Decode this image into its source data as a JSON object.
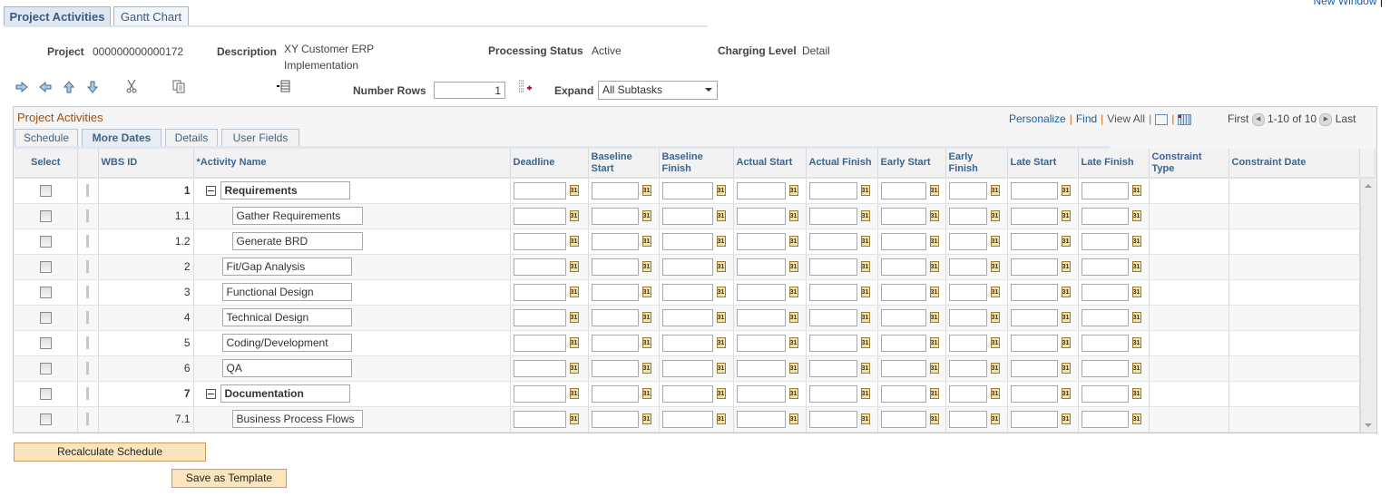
{
  "top_tabs": [
    {
      "label": "Project Activities",
      "active": true
    },
    {
      "label": "Gantt Chart",
      "active": false
    }
  ],
  "new_window": "New Window",
  "header": {
    "project_label": "Project",
    "project_value": "000000000000172",
    "description_label": "Description",
    "description_line1": "XY Customer ERP",
    "description_line2": "Implementation",
    "status_label": "Processing Status",
    "status_value": "Active",
    "charging_label": "Charging Level",
    "charging_value": "Detail"
  },
  "toolbar": {
    "icons": [
      "indent-right-arrow-icon",
      "outdent-left-arrow-icon",
      "move-up-arrow-icon",
      "move-down-arrow-icon",
      "cut-icon",
      "copy-icon",
      "insert-rows-icon"
    ],
    "number_rows_label": "Number Rows",
    "number_rows_value": "1",
    "expand_label": "Expand",
    "expand_value": "All Subtasks"
  },
  "grid": {
    "title": "Project Activities",
    "personalize": "Personalize",
    "find": "Find",
    "view_all": "View All",
    "first": "First",
    "range": "1-10 of 10",
    "last": "Last",
    "subtabs": [
      {
        "label": "Schedule",
        "active": false
      },
      {
        "label": "More Dates",
        "active": true
      },
      {
        "label": "Details",
        "active": false
      },
      {
        "label": "User Fields",
        "active": false
      }
    ],
    "columns": {
      "select": "Select",
      "wbs": "WBS ID",
      "activity": "*Activity Name",
      "deadline": "Deadline",
      "baseline_start_1": "Baseline",
      "baseline_start_2": "Start",
      "baseline_finish_1": "Baseline",
      "baseline_finish_2": "Finish",
      "actual_start": "Actual Start",
      "actual_finish": "Actual Finish",
      "early_start": "Early Start",
      "early_finish": "Early Finish",
      "late_start": "Late Start",
      "late_finish": "Late Finish",
      "constraint_type_1": "Constraint",
      "constraint_type_2": "Type",
      "constraint_date": "Constraint Date"
    },
    "calendar_glyph": "31",
    "rows": [
      {
        "wbs": "1",
        "name": "Requirements",
        "level": 0,
        "summary": true
      },
      {
        "wbs": "1.1",
        "name": "Gather Requirements",
        "level": 1,
        "summary": false
      },
      {
        "wbs": "1.2",
        "name": "Generate BRD",
        "level": 1,
        "summary": false
      },
      {
        "wbs": "2",
        "name": "Fit/Gap Analysis",
        "level": 0,
        "summary": false
      },
      {
        "wbs": "3",
        "name": "Functional Design",
        "level": 0,
        "summary": false
      },
      {
        "wbs": "4",
        "name": "Technical Design",
        "level": 0,
        "summary": false
      },
      {
        "wbs": "5",
        "name": "Coding/Development",
        "level": 0,
        "summary": false
      },
      {
        "wbs": "6",
        "name": "QA",
        "level": 0,
        "summary": false
      },
      {
        "wbs": "7",
        "name": "Documentation",
        "level": 0,
        "summary": true
      },
      {
        "wbs": "7.1",
        "name": "Business Process Flows",
        "level": 1,
        "summary": false
      }
    ]
  },
  "buttons": {
    "recalculate": "Recalculate Schedule",
    "save_template": "Save as Template"
  }
}
